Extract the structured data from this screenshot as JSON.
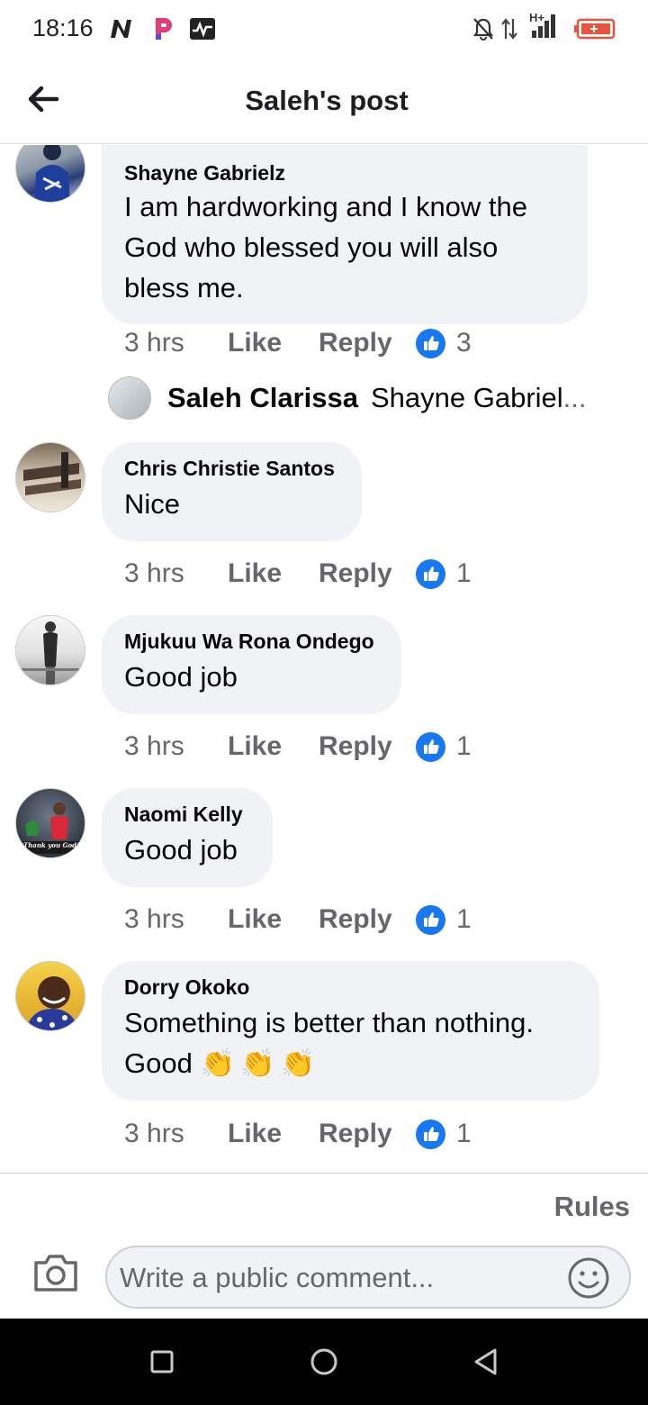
{
  "status_bar": {
    "time": "18:16",
    "icons": [
      "n-app-icon",
      "p-app-icon",
      "activity-icon",
      "bell-off-icon",
      "data-arrows-icon",
      "signal-icon",
      "battery-icon"
    ],
    "network_label": "H+"
  },
  "header": {
    "title": "Saleh's post",
    "back_icon": "arrow-left-icon"
  },
  "comments": [
    {
      "name": "Shayne Gabrielz",
      "text": "I am hardworking and I know the God who blessed you will also bless me.",
      "time": "3 hrs",
      "like_label": "Like",
      "reply_label": "Reply",
      "like_count": "3",
      "reply_preview": {
        "name": "Saleh Clarissa",
        "text": "Shayne Gabriel",
        "ellipsis": "..."
      }
    },
    {
      "name": "Chris Christie Santos",
      "text": "Nice",
      "time": "3 hrs",
      "like_label": "Like",
      "reply_label": "Reply",
      "like_count": "1"
    },
    {
      "name": "Mjukuu Wa Rona Ondego",
      "text": "Good job",
      "time": "3 hrs",
      "like_label": "Like",
      "reply_label": "Reply",
      "like_count": "1"
    },
    {
      "name": "Naomi Kelly",
      "text": "Good job",
      "time": "3 hrs",
      "like_label": "Like",
      "reply_label": "Reply",
      "like_count": "1",
      "avatar_caption": "Thank you God!"
    },
    {
      "name": "Dorry Okoko",
      "text_line1": "Something is better than nothing.",
      "text_line2": "Good",
      "emojis": "👏👏👏",
      "time": "3 hrs",
      "like_label": "Like",
      "reply_label": "Reply",
      "like_count": "1"
    }
  ],
  "composer": {
    "rules_label": "Rules",
    "placeholder": "Write a public comment...",
    "camera_icon": "camera-icon",
    "emoji_icon": "smiley-icon"
  },
  "nav_bar": {
    "buttons": [
      "recents-square-icon",
      "home-circle-icon",
      "back-triangle-icon"
    ]
  },
  "colors": {
    "bubble": "#f0f2f5",
    "secondary_text": "#65676b",
    "like_blue": "#1877f2"
  }
}
